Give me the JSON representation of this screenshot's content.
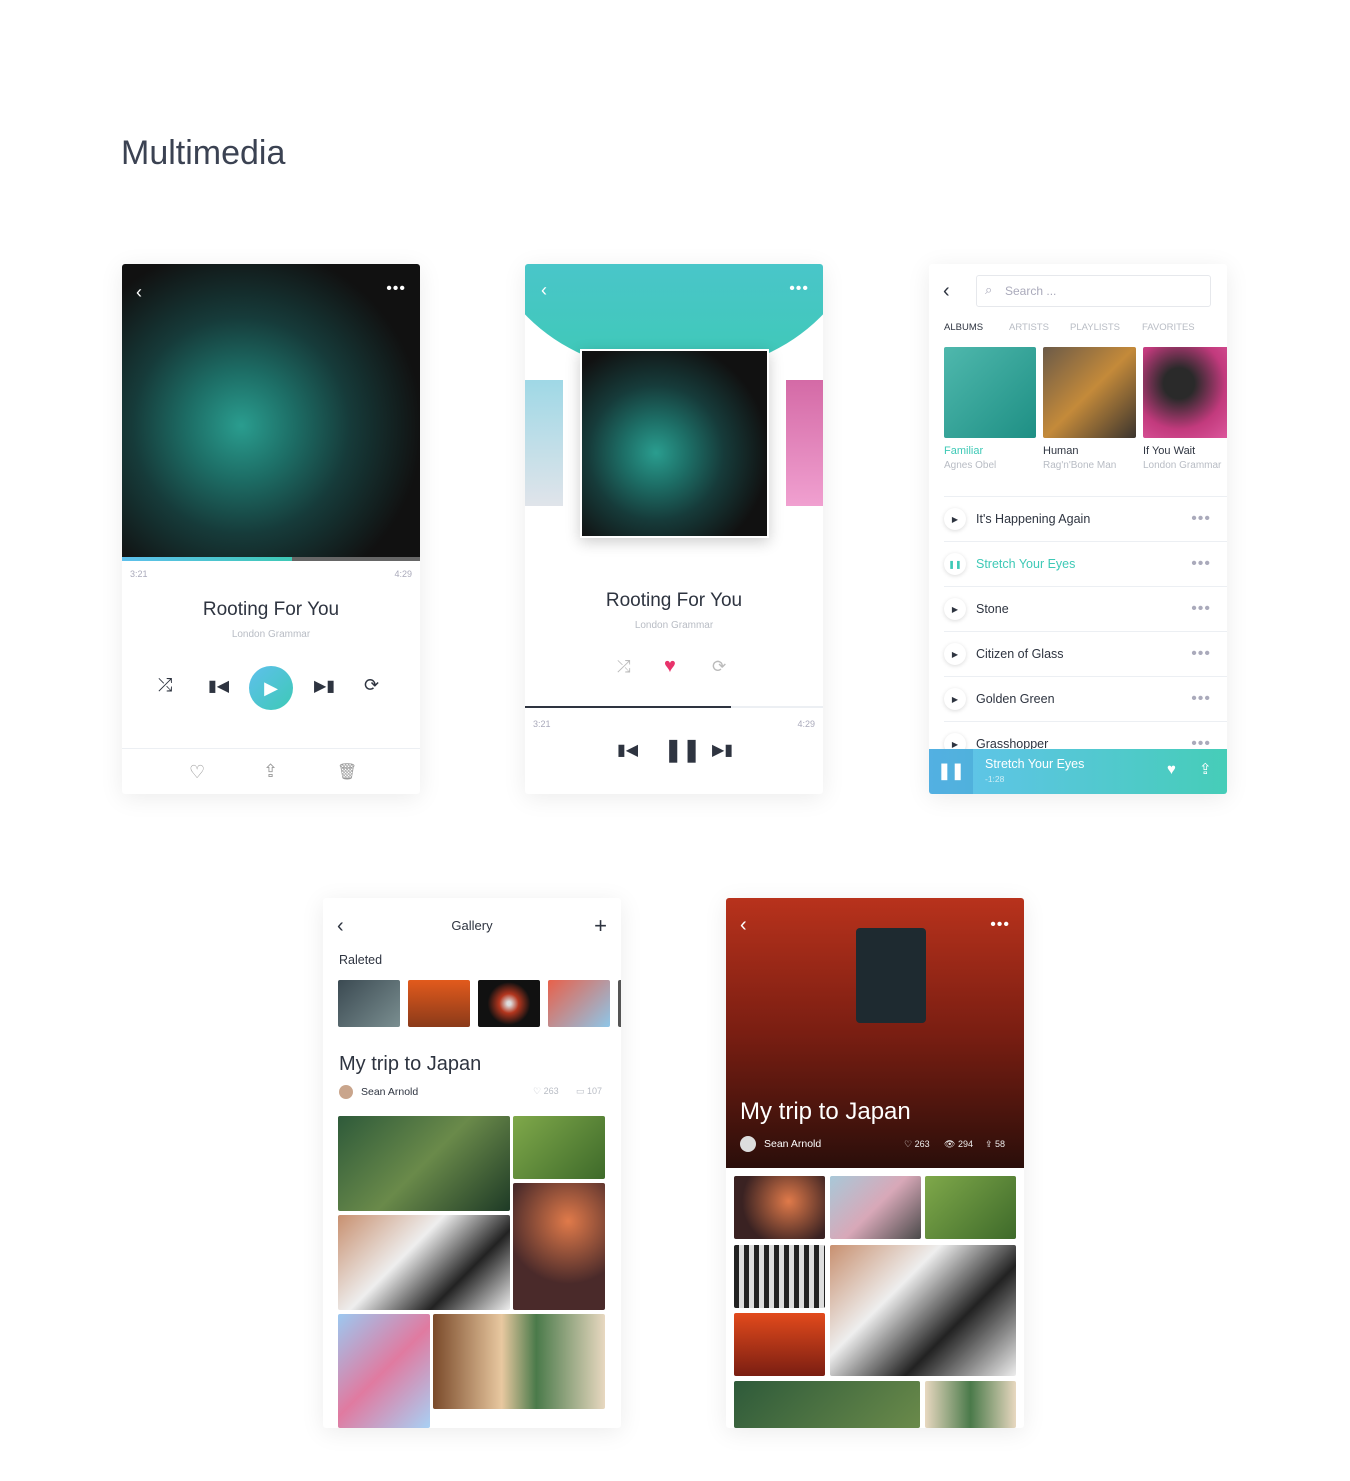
{
  "page_title": "Multimedia",
  "player1": {
    "current_time": "3:21",
    "total_time": "4:29",
    "progress": 0.57,
    "title": "Rooting For You",
    "artist": "London Grammar"
  },
  "player2": {
    "current_time": "3:21",
    "total_time": "4:29",
    "progress": 0.65,
    "title": "Rooting For You",
    "artist": "London Grammar",
    "liked": true
  },
  "library": {
    "search_placeholder": "Search ...",
    "tabs": [
      "ALBUMS",
      "ARTISTS",
      "PLAYLISTS",
      "FAVORITES"
    ],
    "albums": [
      {
        "title": "Familiar",
        "artist": "Agnes Obel"
      },
      {
        "title": "Human",
        "artist": "Rag'n'Bone Man"
      },
      {
        "title": "If You Wait",
        "artist": "London Grammar"
      }
    ],
    "songs": [
      "It's Happening Again",
      "Stretch Your Eyes",
      "Stone",
      "Citizen of Glass",
      "Golden Green",
      "Grasshopper"
    ],
    "now_playing": {
      "title": "Stretch Your Eyes",
      "remaining": "-1:28"
    }
  },
  "gallery": {
    "title": "Gallery",
    "related_label": "Raleted",
    "album_title": "My trip to Japan",
    "author": "Sean Arnold",
    "likes": "263",
    "photos": "107"
  },
  "album_detail": {
    "title": "My trip to Japan",
    "author": "Sean Arnold",
    "likes": "263",
    "views": "294",
    "shares": "58"
  },
  "colors": {
    "accent": "#3ec9b6",
    "accent_blue": "#5ec0ec",
    "heart": "#e8336b",
    "text": "#2e3440"
  }
}
